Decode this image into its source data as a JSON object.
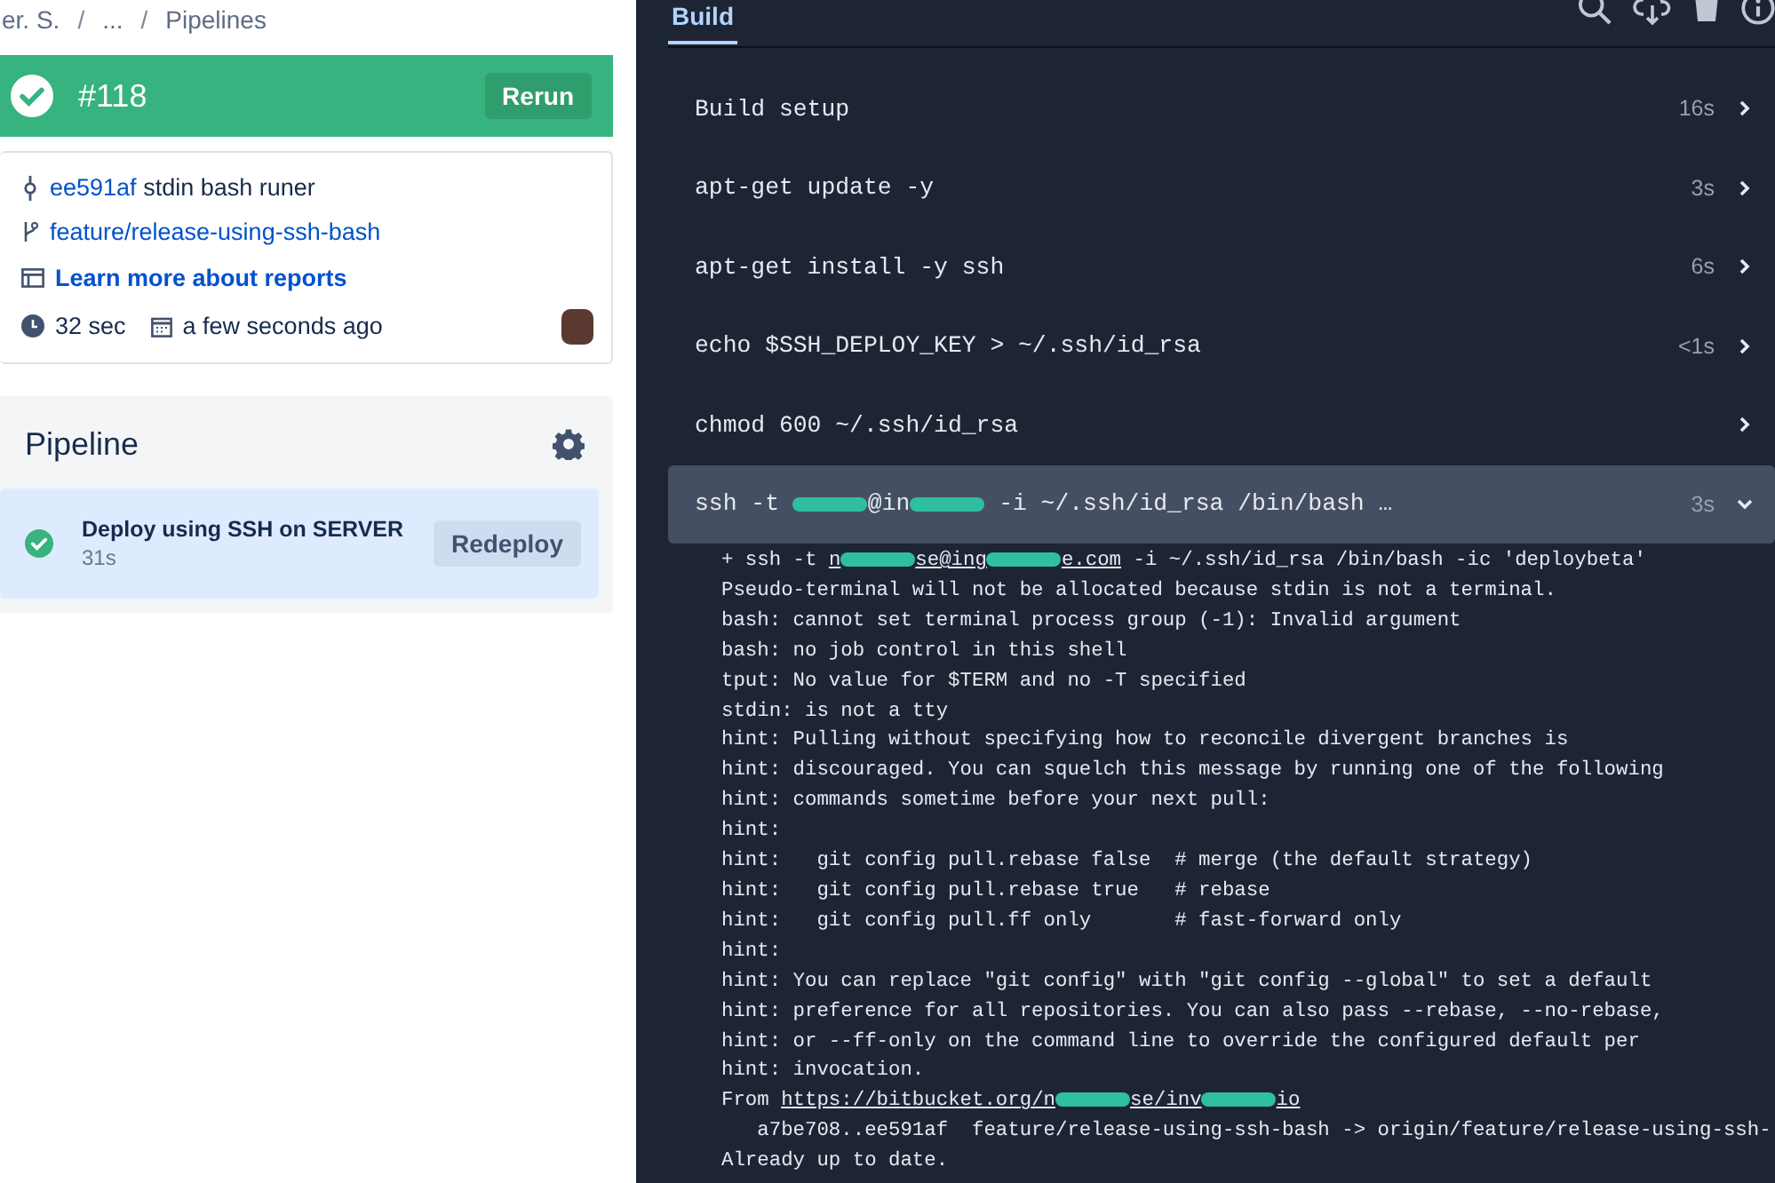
{
  "breadcrumbs": [
    {
      "kind": "crumb",
      "text": "er. S."
    },
    {
      "kind": "separator",
      "text": "/"
    },
    {
      "kind": "crumb",
      "text": "..."
    },
    {
      "kind": "separator",
      "text": "/"
    },
    {
      "kind": "crumb",
      "text": "Pipelines"
    }
  ],
  "build": {
    "passed": true,
    "number": "#118",
    "rerun": "Rerun"
  },
  "details": {
    "commit_hash": "ee591af",
    "commit_message": "stdin bash runer",
    "branch": "feature/release-using-ssh-bash",
    "reports_link": "Learn more about reports",
    "duration": "32 sec",
    "time": "a few seconds ago"
  },
  "pipeline": {
    "title": "Pipeline",
    "steps": [
      {
        "name": "Deploy using SSH on SERVER",
        "duration": "31s",
        "passed": true,
        "selected": true,
        "action": "Redeploy"
      }
    ]
  },
  "log": {
    "tabs": [
      {
        "label": "Build",
        "selected": true
      }
    ],
    "steps": [
      {
        "segments": [
          {
            "kind": "text",
            "text": "Build setup"
          }
        ],
        "duration": "16s",
        "expanded": false
      },
      {
        "segments": [
          {
            "kind": "text",
            "text": "apt-get update -y"
          }
        ],
        "duration": "3s",
        "expanded": false
      },
      {
        "segments": [
          {
            "kind": "text",
            "text": "apt-get install -y ssh"
          }
        ],
        "duration": "6s",
        "expanded": false
      },
      {
        "segments": [
          {
            "kind": "text",
            "text": "echo $SSH_DEPLOY_KEY > ~/.ssh/id_rsa"
          }
        ],
        "duration": "<1s",
        "expanded": false
      },
      {
        "segments": [
          {
            "kind": "text",
            "text": "chmod 600 ~/.ssh/id_rsa"
          }
        ],
        "expanded": false
      },
      {
        "segments": [
          {
            "kind": "text",
            "text": "ssh -t "
          },
          {
            "kind": "redacted"
          },
          {
            "kind": "text",
            "text": "@in"
          },
          {
            "kind": "redacted"
          },
          {
            "kind": "text",
            "text": " -i ~/.ssh/id_rsa /bin/bash …"
          }
        ],
        "duration": "3s",
        "expanded": true
      }
    ],
    "output": [
      {
        "segments": [
          {
            "kind": "text",
            "text": "+ ssh -t "
          },
          {
            "kind": "link",
            "parts": [
              {
                "kind": "text",
                "text": "n"
              },
              {
                "kind": "redacted"
              },
              {
                "kind": "text",
                "text": "se@ing"
              },
              {
                "kind": "redacted"
              },
              {
                "kind": "text",
                "text": "e.com"
              }
            ]
          },
          {
            "kind": "text",
            "text": " -i ~/.ssh/id_rsa /bin/bash -ic 'deploybeta'"
          }
        ]
      },
      {
        "segments": [
          {
            "kind": "text",
            "text": "Pseudo-terminal will not be allocated because stdin is not a terminal."
          }
        ]
      },
      {
        "segments": [
          {
            "kind": "text",
            "text": "bash: cannot set terminal process group (-1): Invalid argument"
          }
        ]
      },
      {
        "segments": [
          {
            "kind": "text",
            "text": "bash: no job control in this shell"
          }
        ]
      },
      {
        "segments": [
          {
            "kind": "text",
            "text": "tput: No value for $TERM and no -T specified"
          }
        ]
      },
      {
        "segments": [
          {
            "kind": "text",
            "text": "stdin: is not a tty"
          }
        ]
      },
      {
        "segments": [
          {
            "kind": "text",
            "text": "hint: Pulling without specifying how to reconcile divergent branches is"
          }
        ]
      },
      {
        "segments": [
          {
            "kind": "text",
            "text": "hint: discouraged. You can squelch this message by running one of the following"
          }
        ]
      },
      {
        "segments": [
          {
            "kind": "text",
            "text": "hint: commands sometime before your next pull:"
          }
        ]
      },
      {
        "segments": [
          {
            "kind": "text",
            "text": "hint:"
          }
        ]
      },
      {
        "segments": [
          {
            "kind": "text",
            "text": "hint:   git config pull.rebase false  # merge (the default strategy)"
          }
        ]
      },
      {
        "segments": [
          {
            "kind": "text",
            "text": "hint:   git config pull.rebase true   # rebase"
          }
        ]
      },
      {
        "segments": [
          {
            "kind": "text",
            "text": "hint:   git config pull.ff only       # fast-forward only"
          }
        ]
      },
      {
        "segments": [
          {
            "kind": "text",
            "text": "hint:"
          }
        ]
      },
      {
        "segments": [
          {
            "kind": "text",
            "text": "hint: You can replace \"git config\" with \"git config --global\" to set a default"
          }
        ]
      },
      {
        "segments": [
          {
            "kind": "text",
            "text": "hint: preference for all repositories. You can also pass --rebase, --no-rebase,"
          }
        ]
      },
      {
        "segments": [
          {
            "kind": "text",
            "text": "hint: or --ff-only on the command line to override the configured default per"
          }
        ]
      },
      {
        "segments": [
          {
            "kind": "text",
            "text": "hint: invocation."
          }
        ]
      },
      {
        "segments": [
          {
            "kind": "text",
            "text": "From "
          },
          {
            "kind": "link",
            "parts": [
              {
                "kind": "text",
                "text": "https://bitbucket.org/n"
              },
              {
                "kind": "redacted"
              },
              {
                "kind": "text",
                "text": "se/inv"
              },
              {
                "kind": "redacted"
              },
              {
                "kind": "text",
                "text": "io"
              }
            ]
          }
        ]
      },
      {
        "segments": [
          {
            "kind": "text",
            "text": "   a7be708..ee591af  feature/release-using-ssh-bash -> origin/feature/release-using-ssh-"
          }
        ]
      },
      {
        "segments": [
          {
            "kind": "text",
            "text": "Already up to date."
          }
        ]
      }
    ]
  }
}
